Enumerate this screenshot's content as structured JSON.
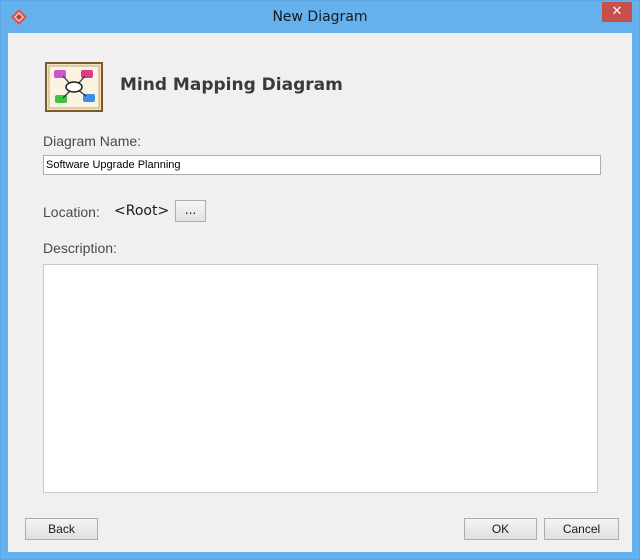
{
  "window": {
    "title": "New Diagram",
    "close_label": "✕"
  },
  "header": {
    "diagram_type": "Mind Mapping Diagram",
    "icon": "mind-map-diagram-icon"
  },
  "form": {
    "diagram_name_label": "Diagram Name:",
    "diagram_name_value": "Software Upgrade Planning",
    "location_label": "Location:",
    "location_value": "<Root>",
    "browse_label": "...",
    "description_label": "Description:",
    "description_value": ""
  },
  "footer": {
    "back_label": "Back",
    "ok_label": "OK",
    "cancel_label": "Cancel"
  },
  "colors": {
    "titlebar": "#64b1ee",
    "close_button": "#c7504b",
    "client_background": "#f0f0f0"
  }
}
